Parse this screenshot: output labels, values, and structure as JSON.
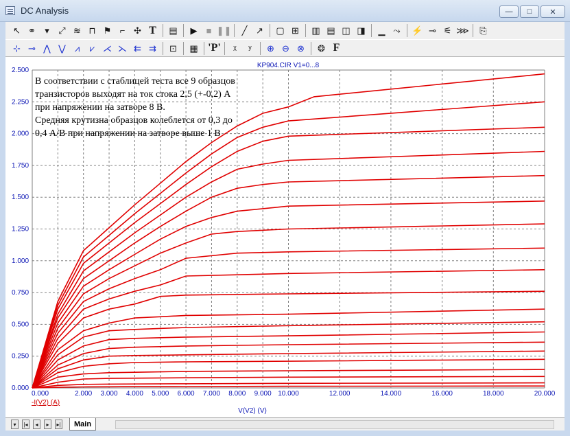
{
  "window": {
    "title": "DC Analysis",
    "minimize_glyph": "—",
    "maximize_glyph": "□",
    "close_glyph": "✕"
  },
  "toolbar_row1": [
    {
      "name": "select-arrow-icon",
      "glyph": "↖"
    },
    {
      "name": "node-select-icon",
      "glyph": "⚭"
    },
    {
      "name": "dropdown-icon",
      "glyph": "▾"
    },
    {
      "name": "scale-icon",
      "glyph": "⤢"
    },
    {
      "name": "wave-icon",
      "glyph": "≋"
    },
    {
      "name": "tokens-icon",
      "glyph": "⊓"
    },
    {
      "name": "flag-icon",
      "glyph": "⚑"
    },
    {
      "name": "graph-node-icon",
      "glyph": "⌐"
    },
    {
      "name": "cross-icon",
      "glyph": "✣"
    },
    {
      "name": "text-tool-icon",
      "glyph": "T"
    },
    {
      "name": "sep",
      "glyph": ""
    },
    {
      "name": "properties-icon",
      "glyph": "▤"
    },
    {
      "name": "sep",
      "glyph": ""
    },
    {
      "name": "run-icon",
      "glyph": "▶"
    },
    {
      "name": "stop-icon",
      "glyph": "■"
    },
    {
      "name": "pause-icon",
      "glyph": "❚❚"
    },
    {
      "name": "sep",
      "glyph": ""
    },
    {
      "name": "line-tool-icon",
      "glyph": "╱"
    },
    {
      "name": "arrow-line-icon",
      "glyph": "↗"
    },
    {
      "name": "sep",
      "glyph": ""
    },
    {
      "name": "frame-icon",
      "glyph": "▢"
    },
    {
      "name": "grid-icon",
      "glyph": "⊞"
    },
    {
      "name": "sep",
      "glyph": ""
    },
    {
      "name": "grid-dense-icon",
      "glyph": "▥"
    },
    {
      "name": "grid-rows-icon",
      "glyph": "▤"
    },
    {
      "name": "grid-cols-icon",
      "glyph": "◫"
    },
    {
      "name": "grid-split-icon",
      "glyph": "◨"
    },
    {
      "name": "sep",
      "glyph": ""
    },
    {
      "name": "baseline-icon",
      "glyph": "▁"
    },
    {
      "name": "cursor-icon",
      "glyph": "⤳"
    },
    {
      "name": "sep",
      "glyph": ""
    },
    {
      "name": "probe-icon",
      "glyph": "⚡"
    },
    {
      "name": "tag-icon",
      "glyph": "⊸"
    },
    {
      "name": "bias-icon",
      "glyph": "⚟"
    },
    {
      "name": "sweep-icon",
      "glyph": "⋙"
    },
    {
      "name": "sep",
      "glyph": ""
    },
    {
      "name": "output-icon",
      "glyph": "⎘"
    }
  ],
  "toolbar_row2": [
    {
      "name": "peak-left-icon",
      "glyph": "⊹"
    },
    {
      "name": "peak-right-icon",
      "glyph": "⊸"
    },
    {
      "name": "max-icon",
      "glyph": "⋀"
    },
    {
      "name": "min-icon",
      "glyph": "⋁"
    },
    {
      "name": "slope-up-icon",
      "glyph": "⩘"
    },
    {
      "name": "slope-down-icon",
      "glyph": "⩗"
    },
    {
      "name": "cross-up-icon",
      "glyph": "⋌"
    },
    {
      "name": "cross-down-icon",
      "glyph": "⋋"
    },
    {
      "name": "go-left-icon",
      "glyph": "⇇"
    },
    {
      "name": "go-right-icon",
      "glyph": "⇉"
    },
    {
      "name": "sep",
      "glyph": ""
    },
    {
      "name": "data-icon",
      "glyph": "⊡"
    },
    {
      "name": "sep",
      "glyph": ""
    },
    {
      "name": "table-icon",
      "glyph": "▦"
    },
    {
      "name": "sep",
      "glyph": ""
    },
    {
      "name": "label-p-icon",
      "glyph": "'P'"
    },
    {
      "name": "sep",
      "glyph": ""
    },
    {
      "name": "x-axis-label-icon",
      "glyph": "ᵡ"
    },
    {
      "name": "y-axis-label-icon",
      "glyph": "ʸ"
    },
    {
      "name": "sep",
      "glyph": ""
    },
    {
      "name": "zoom-in-icon",
      "glyph": "⊕"
    },
    {
      "name": "zoom-out-icon",
      "glyph": "⊖"
    },
    {
      "name": "zoom-fit-icon",
      "glyph": "⊗"
    },
    {
      "name": "sep",
      "glyph": ""
    },
    {
      "name": "palette-icon",
      "glyph": "❂"
    },
    {
      "name": "font-icon",
      "glyph": "F"
    }
  ],
  "plot": {
    "header": "KP904.CIR V1=0...8",
    "annotation_lines": [
      "В соответствии с стаблицей теста все 9 образцов",
      "транзисторов выходят на ток стока 2,5 (+-0,2) А",
      "при напряжении на затворе 8 В.",
      "Средняя крутизна образцов колеблется от 0,3 до",
      "0,4 А/В при напряжении на затворе выше 1 В"
    ],
    "grid_color": "#7f7f7f",
    "curve_color": "#e00000",
    "axis_text_color": "#0a14b4",
    "ylabel_color": "#d00000"
  },
  "chart_data": {
    "type": "line",
    "title": "KP904.CIR V1=0...8",
    "xlabel": "V(V2) (V)",
    "ylabel": "-I(V2) (A)",
    "xlim": [
      0,
      20
    ],
    "ylim": [
      0,
      2.5
    ],
    "grid": true,
    "x_ticks": [
      0,
      1,
      2,
      3,
      4,
      5,
      6,
      7,
      8,
      9,
      10,
      12,
      14,
      16,
      18,
      20
    ],
    "x_tick_labels": [
      "0.000",
      "",
      "2.000",
      "3.000",
      "4.000",
      "5.000",
      "6.000",
      "7.000",
      "8.000",
      "9.000",
      "10.000",
      "12.000",
      "14.000",
      "16.000",
      "18.000",
      "20.000"
    ],
    "y_ticks": [
      0,
      0.25,
      0.5,
      0.75,
      1.0,
      1.25,
      1.5,
      1.75,
      2.0,
      2.25,
      2.5
    ],
    "y_tick_labels": [
      "0.000",
      "0.250",
      "0.500",
      "0.750",
      "1.000",
      "1.250",
      "1.500",
      "1.750",
      "2.000",
      "2.250",
      "2.500"
    ],
    "series": [
      {
        "values": [
          [
            0,
            0
          ],
          [
            1,
            0.005
          ],
          [
            2,
            0.008
          ],
          [
            3,
            0.009
          ],
          [
            4,
            0.01
          ],
          [
            6,
            0.011
          ],
          [
            10,
            0.013
          ],
          [
            20,
            0.015
          ]
        ]
      },
      {
        "values": [
          [
            0,
            0
          ],
          [
            1,
            0.02
          ],
          [
            2,
            0.028
          ],
          [
            3,
            0.03
          ],
          [
            6,
            0.033
          ],
          [
            10,
            0.036
          ],
          [
            20,
            0.04
          ]
        ]
      },
      {
        "values": [
          [
            0,
            0
          ],
          [
            1,
            0.045
          ],
          [
            2,
            0.07
          ],
          [
            3,
            0.075
          ],
          [
            6,
            0.08
          ],
          [
            10,
            0.085
          ],
          [
            20,
            0.09
          ]
        ]
      },
      {
        "values": [
          [
            0,
            0
          ],
          [
            1,
            0.085
          ],
          [
            2,
            0.11
          ],
          [
            3,
            0.12
          ],
          [
            6,
            0.13
          ],
          [
            10,
            0.135
          ],
          [
            20,
            0.145
          ]
        ]
      },
      {
        "values": [
          [
            0,
            0
          ],
          [
            1,
            0.12
          ],
          [
            2,
            0.17
          ],
          [
            3,
            0.19
          ],
          [
            4,
            0.2
          ],
          [
            6,
            0.205
          ],
          [
            10,
            0.21
          ],
          [
            20,
            0.225
          ]
        ]
      },
      {
        "values": [
          [
            0,
            0
          ],
          [
            1,
            0.15
          ],
          [
            2,
            0.22
          ],
          [
            3,
            0.25
          ],
          [
            4,
            0.255
          ],
          [
            6,
            0.26
          ],
          [
            10,
            0.27
          ],
          [
            20,
            0.29
          ]
        ]
      },
      {
        "values": [
          [
            0,
            0
          ],
          [
            1,
            0.18
          ],
          [
            2,
            0.27
          ],
          [
            3,
            0.31
          ],
          [
            4,
            0.32
          ],
          [
            6,
            0.33
          ],
          [
            10,
            0.34
          ],
          [
            20,
            0.36
          ]
        ]
      },
      {
        "values": [
          [
            0,
            0
          ],
          [
            1,
            0.22
          ],
          [
            2,
            0.33
          ],
          [
            3,
            0.38
          ],
          [
            4,
            0.39
          ],
          [
            6,
            0.4
          ],
          [
            10,
            0.41
          ],
          [
            20,
            0.44
          ]
        ]
      },
      {
        "values": [
          [
            0,
            0
          ],
          [
            1,
            0.26
          ],
          [
            2,
            0.4
          ],
          [
            3,
            0.45
          ],
          [
            4,
            0.46
          ],
          [
            6,
            0.475
          ],
          [
            10,
            0.49
          ],
          [
            20,
            0.52
          ]
        ]
      },
      {
        "values": [
          [
            0,
            0
          ],
          [
            1,
            0.3
          ],
          [
            2,
            0.45
          ],
          [
            3,
            0.51
          ],
          [
            4,
            0.55
          ],
          [
            5,
            0.56
          ],
          [
            6,
            0.57
          ],
          [
            10,
            0.58
          ],
          [
            20,
            0.62
          ]
        ]
      },
      {
        "values": [
          [
            0,
            0
          ],
          [
            1,
            0.35
          ],
          [
            2,
            0.55
          ],
          [
            3,
            0.62
          ],
          [
            4,
            0.66
          ],
          [
            5,
            0.72
          ],
          [
            6,
            0.73
          ],
          [
            10,
            0.74
          ],
          [
            20,
            0.76
          ]
        ]
      },
      {
        "values": [
          [
            0,
            0
          ],
          [
            1,
            0.39
          ],
          [
            2,
            0.62
          ],
          [
            3,
            0.7
          ],
          [
            4,
            0.76
          ],
          [
            5,
            0.81
          ],
          [
            6,
            0.88
          ],
          [
            8,
            0.89
          ],
          [
            10,
            0.9
          ],
          [
            20,
            0.93
          ]
        ]
      },
      {
        "values": [
          [
            0,
            0
          ],
          [
            1,
            0.43
          ],
          [
            2,
            0.68
          ],
          [
            3,
            0.78
          ],
          [
            4,
            0.86
          ],
          [
            5,
            0.93
          ],
          [
            6,
            1.02
          ],
          [
            8,
            1.06
          ],
          [
            10,
            1.07
          ],
          [
            20,
            1.1
          ]
        ]
      },
      {
        "values": [
          [
            0,
            0
          ],
          [
            1,
            0.47
          ],
          [
            2,
            0.74
          ],
          [
            3,
            0.86
          ],
          [
            4,
            0.96
          ],
          [
            5,
            1.06
          ],
          [
            6,
            1.14
          ],
          [
            7,
            1.21
          ],
          [
            8,
            1.23
          ],
          [
            10,
            1.25
          ],
          [
            20,
            1.29
          ]
        ]
      },
      {
        "values": [
          [
            0,
            0
          ],
          [
            1,
            0.51
          ],
          [
            2,
            0.8
          ],
          [
            3,
            0.93
          ],
          [
            4,
            1.05
          ],
          [
            5,
            1.17
          ],
          [
            6,
            1.27
          ],
          [
            7,
            1.34
          ],
          [
            8,
            1.39
          ],
          [
            9,
            1.41
          ],
          [
            10,
            1.43
          ],
          [
            20,
            1.47
          ]
        ]
      },
      {
        "values": [
          [
            0,
            0
          ],
          [
            1,
            0.55
          ],
          [
            2,
            0.86
          ],
          [
            3,
            1.0
          ],
          [
            4,
            1.14
          ],
          [
            5,
            1.27
          ],
          [
            6,
            1.39
          ],
          [
            7,
            1.5
          ],
          [
            8,
            1.57
          ],
          [
            9,
            1.6
          ],
          [
            10,
            1.62
          ],
          [
            20,
            1.67
          ]
        ]
      },
      {
        "values": [
          [
            0,
            0
          ],
          [
            1,
            0.58
          ],
          [
            2,
            0.92
          ],
          [
            3,
            1.07
          ],
          [
            4,
            1.22
          ],
          [
            5,
            1.36
          ],
          [
            6,
            1.5
          ],
          [
            7,
            1.62
          ],
          [
            8,
            1.72
          ],
          [
            9,
            1.76
          ],
          [
            10,
            1.79
          ],
          [
            20,
            1.86
          ]
        ]
      },
      {
        "values": [
          [
            0,
            0
          ],
          [
            1,
            0.62
          ],
          [
            2,
            0.98
          ],
          [
            3,
            1.14
          ],
          [
            4,
            1.3
          ],
          [
            5,
            1.45
          ],
          [
            6,
            1.6
          ],
          [
            7,
            1.74
          ],
          [
            8,
            1.86
          ],
          [
            9,
            1.94
          ],
          [
            10,
            1.98
          ],
          [
            20,
            2.05
          ]
        ]
      },
      {
        "values": [
          [
            0,
            0
          ],
          [
            1,
            0.65
          ],
          [
            2,
            1.03
          ],
          [
            3,
            1.2
          ],
          [
            4,
            1.37
          ],
          [
            5,
            1.53
          ],
          [
            6,
            1.69
          ],
          [
            7,
            1.84
          ],
          [
            8,
            1.97
          ],
          [
            9,
            2.05
          ],
          [
            10,
            2.1
          ],
          [
            20,
            2.25
          ]
        ]
      },
      {
        "values": [
          [
            0,
            0
          ],
          [
            1,
            0.68
          ],
          [
            2,
            1.08
          ],
          [
            3,
            1.26
          ],
          [
            4,
            1.44
          ],
          [
            5,
            1.61
          ],
          [
            6,
            1.78
          ],
          [
            7,
            1.93
          ],
          [
            8,
            2.06
          ],
          [
            9,
            2.16
          ],
          [
            10,
            2.21
          ],
          [
            11,
            2.29
          ],
          [
            20,
            2.47
          ]
        ]
      }
    ]
  },
  "footer": {
    "sheet_tab": "Main",
    "nav_first": "|◂",
    "nav_prev": "◂",
    "nav_next": "▸",
    "nav_last": "▸|",
    "nav_down": "▾"
  }
}
